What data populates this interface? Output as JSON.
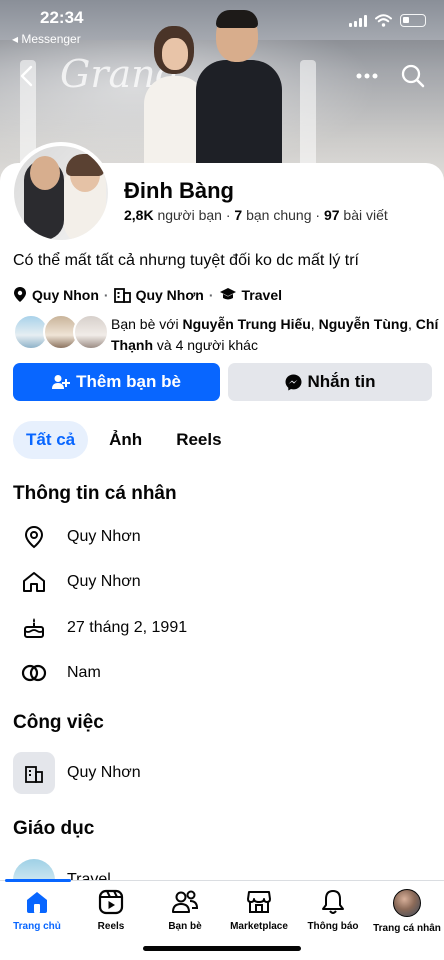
{
  "status_bar": {
    "time": "22:34",
    "back_app": "Messenger"
  },
  "profile": {
    "name": "Đinh Bàng",
    "friends_count": "2,8K",
    "friends_label": "người bạn",
    "mutual_count": "7",
    "mutual_label": "bạn chung",
    "posts_count": "97",
    "posts_label": "bài viết",
    "bio": "Có thể mất tất cả nhưng tuyệt đối ko dc mất lý trí",
    "meta": {
      "location": "Quy Nhon",
      "hometown": "Quy Nhơn",
      "education": "Travel"
    },
    "mutual_friends": {
      "prefix": "Bạn bè với",
      "name1": "Nguyễn Trung Hiếu",
      "name2": "Nguyễn Tùng",
      "name3": "Chí Thạnh",
      "suffix": "và 4 người khác"
    }
  },
  "buttons": {
    "add_friend": "Thêm bạn bè",
    "message": "Nhắn tin"
  },
  "tabs": [
    {
      "label": "Tất cả",
      "active": true
    },
    {
      "label": "Ảnh",
      "active": false
    },
    {
      "label": "Reels",
      "active": false
    }
  ],
  "personal_info": {
    "title": "Thông tin cá nhân",
    "items": [
      {
        "icon": "location-pin-icon",
        "value": "Quy Nhơn"
      },
      {
        "icon": "home-icon",
        "value": "Quy Nhơn"
      },
      {
        "icon": "birthday-cake-icon",
        "value": "27 tháng 2, 1991"
      },
      {
        "icon": "gender-rings-icon",
        "value": "Nam"
      }
    ]
  },
  "work": {
    "title": "Công việc",
    "value": "Quy Nhơn"
  },
  "education": {
    "title": "Giáo dục",
    "value": "Travel"
  },
  "bottom_nav": [
    {
      "label": "Trang chủ",
      "icon": "home-icon",
      "active": true
    },
    {
      "label": "Reels",
      "icon": "reels-icon",
      "active": false
    },
    {
      "label": "Bạn bè",
      "icon": "friends-icon",
      "active": false
    },
    {
      "label": "Marketplace",
      "icon": "marketplace-icon",
      "active": false
    },
    {
      "label": "Thông báo",
      "icon": "bell-icon",
      "active": false
    },
    {
      "label": "Trang cá nhân",
      "icon": "profile-avatar-icon",
      "active": false
    }
  ],
  "colors": {
    "accent": "#0866ff",
    "secondary_button": "#e4e6eb",
    "text": "#050505"
  }
}
